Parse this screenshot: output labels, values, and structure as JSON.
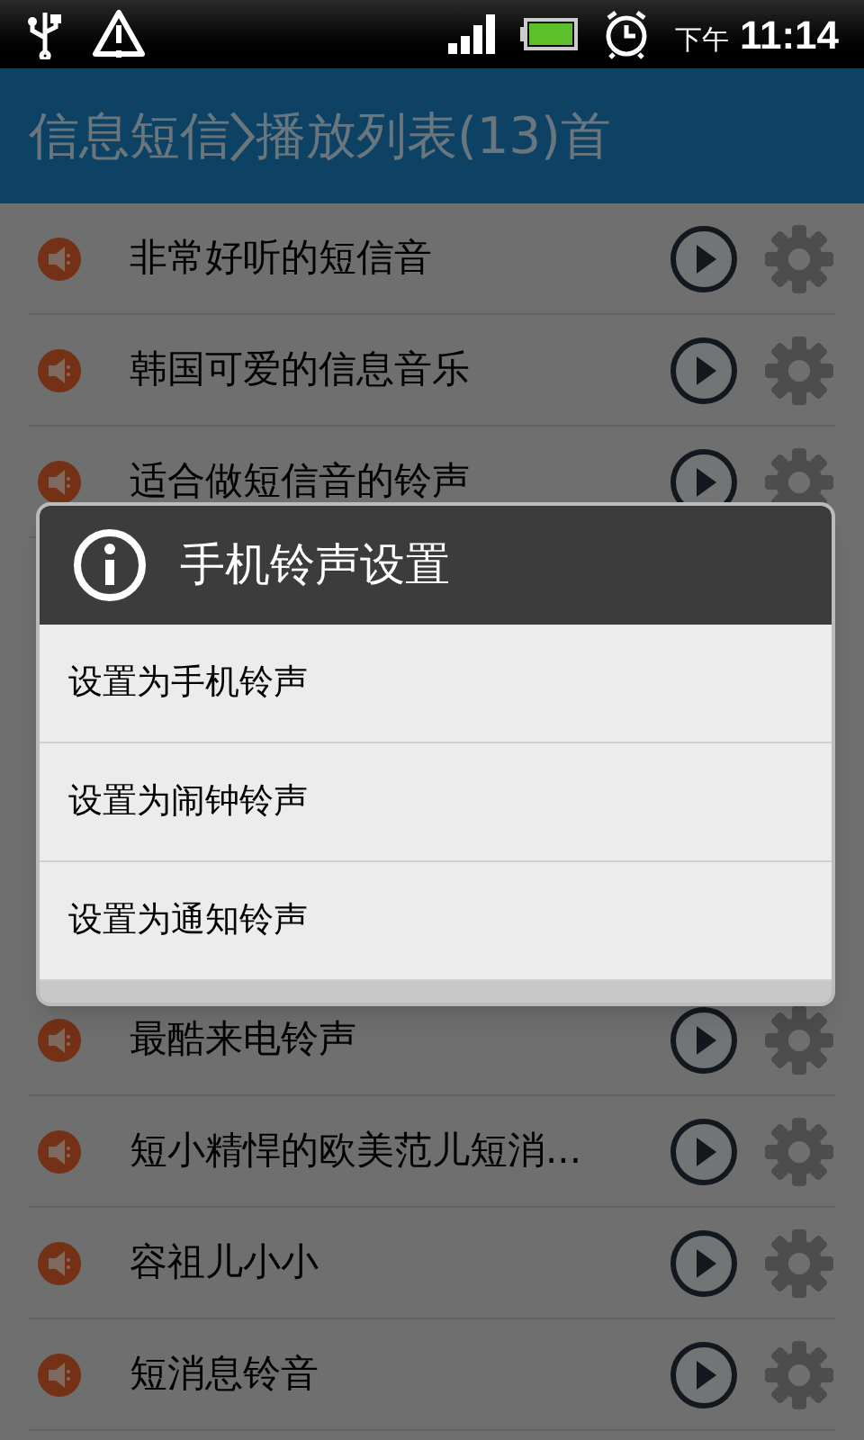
{
  "status_bar": {
    "period": "下午",
    "time": "11:14"
  },
  "title_bar": {
    "category": "信息短信",
    "playlist": "播放列表(13)首"
  },
  "rows_above": [
    {
      "title": "非常好听的短信音"
    },
    {
      "title": "韩国可爱的信息音乐"
    },
    {
      "title": "适合做短信音的铃声"
    }
  ],
  "rows_below": [
    {
      "title": "最酷来电铃声"
    },
    {
      "title": "短小精悍的欧美范儿短消..."
    },
    {
      "title": "容祖儿小小"
    },
    {
      "title": "短消息铃音"
    }
  ],
  "dialog": {
    "title": "手机铃声设置",
    "options": [
      {
        "label": "设置为手机铃声"
      },
      {
        "label": "设置为闹钟铃声"
      },
      {
        "label": "设置为通知铃声"
      }
    ]
  }
}
